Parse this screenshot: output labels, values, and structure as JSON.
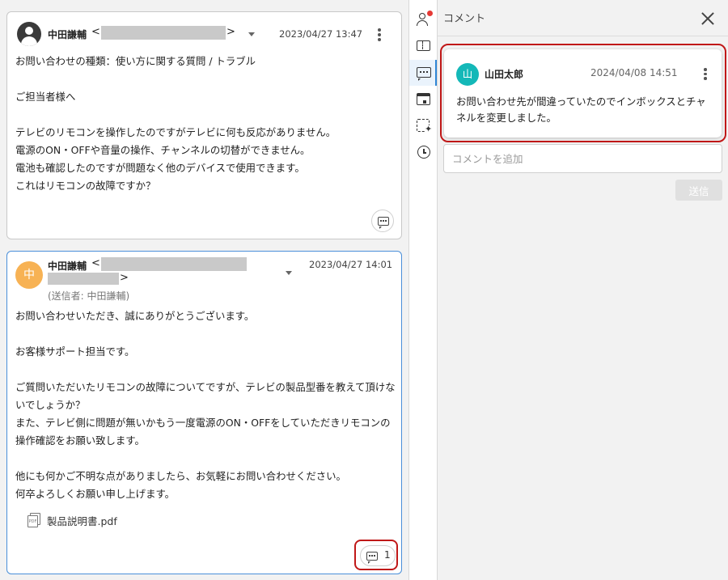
{
  "messages": [
    {
      "sender": "中田謙輔",
      "bracket_open": "<",
      "bracket_close": ">",
      "date": "2023/04/27 13:47",
      "body": "お問い合わせの種類：使い方に関する質問 / トラブル\n\nご担当者様へ\n\nテレビのリモコンを操作したのですがテレビに何も反応がありません。\n電源のON・OFFや音量の操作、チャンネルの切替ができません。\n電池も確認したのですが問題なく他のデバイスで使用できます。\nこれはリモコンの故障ですか？"
    },
    {
      "avatar": "中",
      "sender": "中田謙輔",
      "bracket_open": "<",
      "bracket_close": ">",
      "date": "2023/04/27 14:01",
      "sent_by": "(送信者: 中田謙輔)",
      "body": "お問い合わせいただき、誠にありがとうございます。\n\nお客様サポート担当です。\n\nご質問いただいたリモコンの故障についてですが、テレビの製品型番を教えて頂けないでしょうか？\nまた、テレビ側に問題が無いかもう一度電源のON・OFFをしていただきリモコンの操作確認をお願い致します。\n\n他にも何かご不明な点がありましたら、お気軽にお問い合わせください。\n何卒よろしくお願い申し上げます。",
      "attachment": "製品説明書.pdf",
      "pdf_label": "PDF",
      "comment_count": "1"
    }
  ],
  "panel": {
    "title": "コメント",
    "comment": {
      "avatar": "山",
      "author": "山田太郎",
      "date": "2024/04/08 14:51",
      "text": "お問い合わせ先が間違っていたのでインボックスとチャネルを変更しました。"
    },
    "input_placeholder": "コメントを追加",
    "send_label": "送信"
  },
  "colors": {
    "active_accent": "#2f86d6",
    "highlight": "#c01818",
    "avatar_orange": "#f7b254",
    "avatar_teal": "#14b8b8",
    "notification_dot": "#e53935"
  },
  "icons": [
    "person-icon",
    "ticket-icon",
    "chat-icon",
    "calendar-icon",
    "sparkle-icon",
    "alarm-icon",
    "close-icon",
    "kebab-icon",
    "comment-icon",
    "pdf-icon"
  ]
}
